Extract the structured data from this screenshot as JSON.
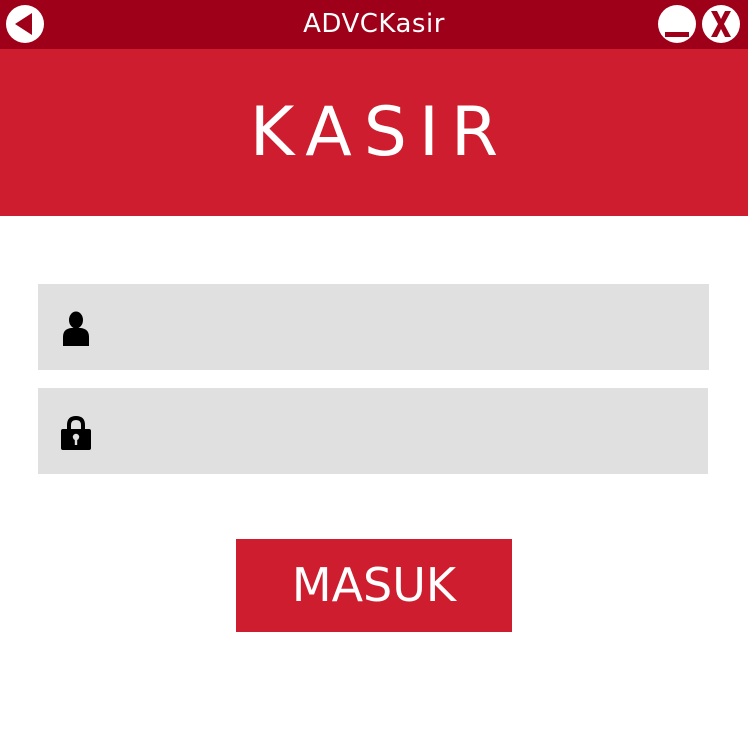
{
  "window": {
    "title": "ADVCKasir"
  },
  "header": {
    "title": "KASIR"
  },
  "login": {
    "username": {
      "icon": "user-icon",
      "value": "",
      "placeholder": ""
    },
    "password": {
      "icon": "lock-icon",
      "value": "",
      "placeholder": ""
    },
    "submit_label": "MASUK"
  },
  "colors": {
    "titlebar": "#9e0019",
    "accent": "#cd1d2e",
    "field_bg": "#e0e0e0",
    "text_on_accent": "#ffffff"
  }
}
